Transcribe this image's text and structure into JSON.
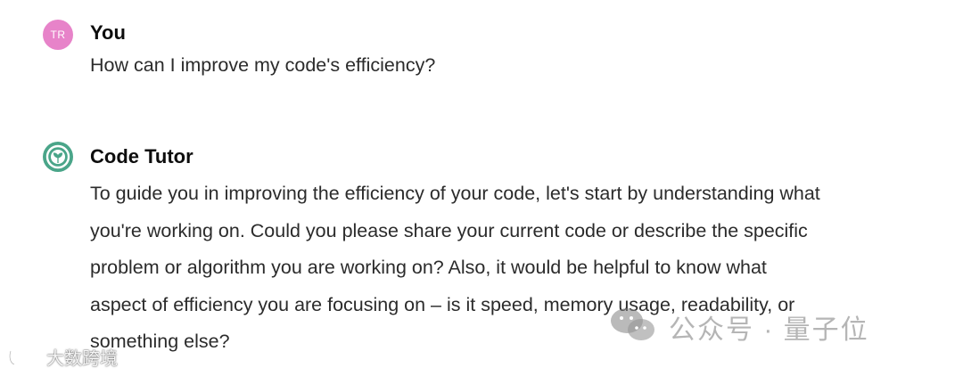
{
  "messages": [
    {
      "author": "You",
      "avatar_initials": "TR",
      "text": "How can I improve my code's efficiency?"
    },
    {
      "author": "Code Tutor",
      "avatar_icon": "code-tutor-logo-icon",
      "lines": [
        "To guide you in improving the efficiency of your code, let's start by understanding what",
        "you're working on. Could you please share your current code or describe the specific",
        "problem or algorithm you are working on? Also, it would be helpful to know what",
        "aspect of efficiency you are focusing on – is it speed, memory usage, readability, or",
        "something else?"
      ]
    }
  ],
  "watermarks": {
    "right": "公众号 · 量子位",
    "left": "大数跨境"
  },
  "colors": {
    "user_avatar": "#e783c9",
    "bot_avatar": "#4aa589"
  }
}
